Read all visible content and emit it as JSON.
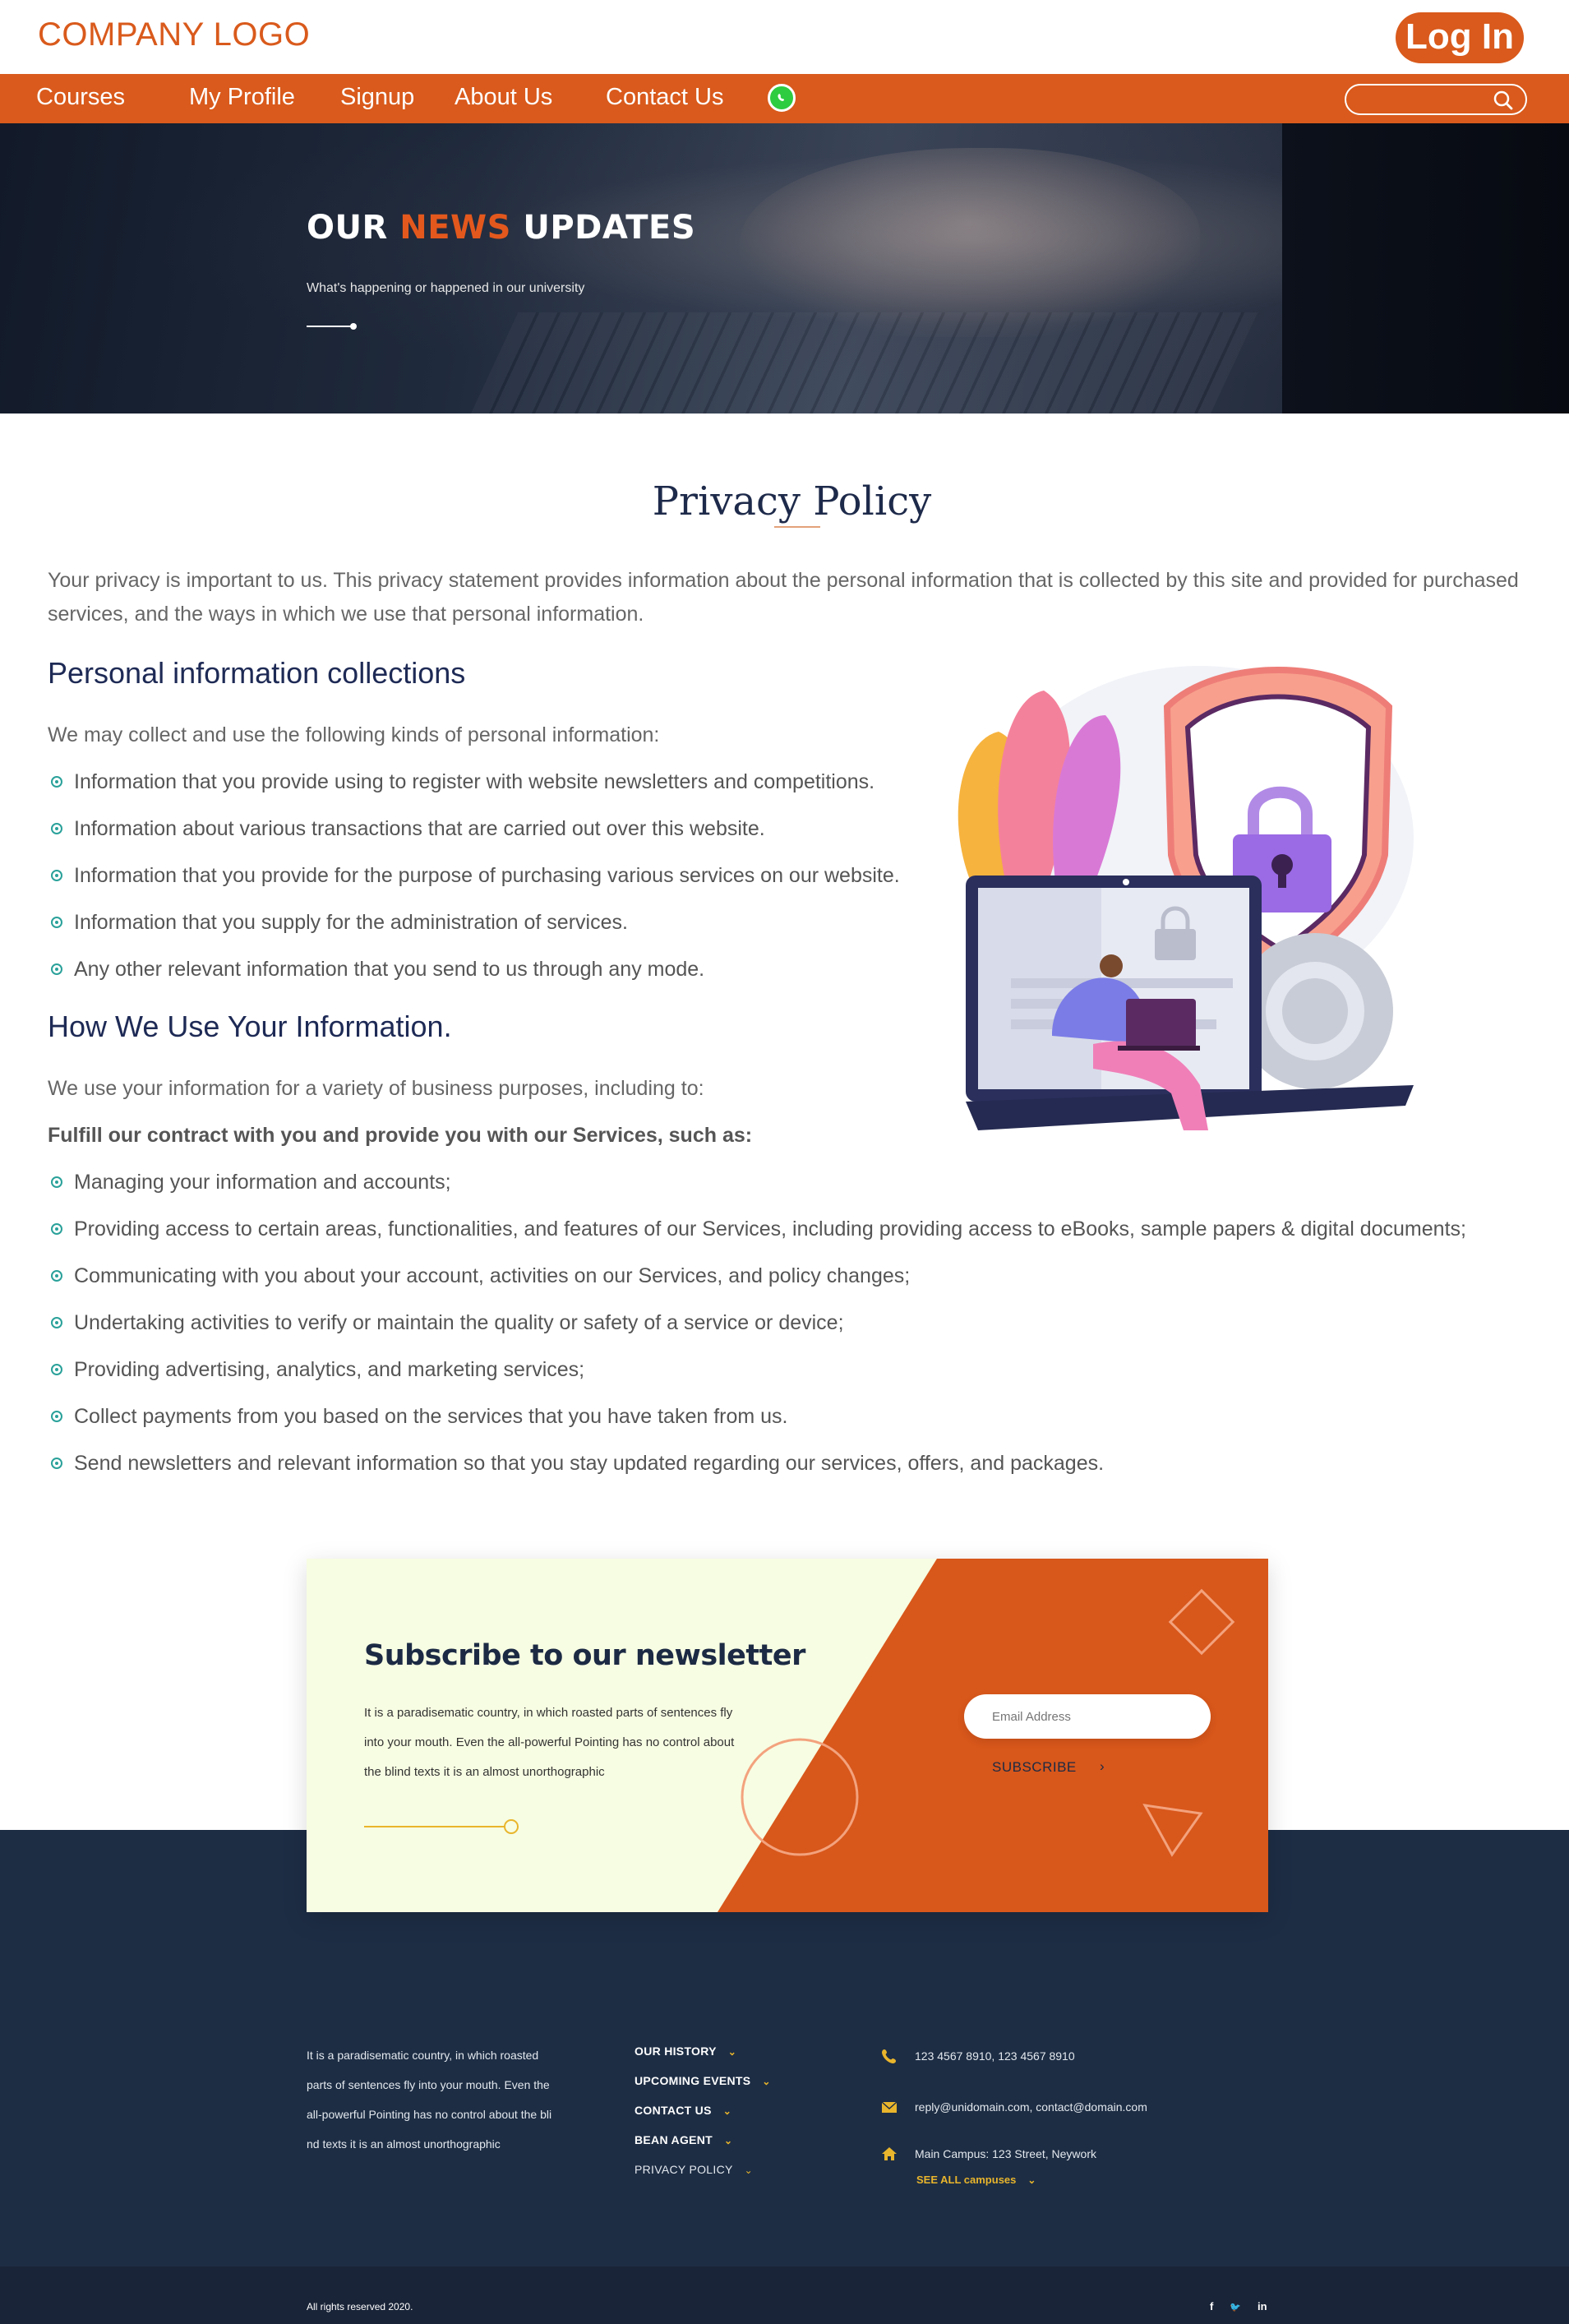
{
  "header": {
    "logo": "COMPANY LOGO",
    "login_label": "Log In"
  },
  "nav": {
    "items": [
      {
        "label": "Courses"
      },
      {
        "label": "My Profile"
      },
      {
        "label": "Signup"
      },
      {
        "label": "About Us"
      },
      {
        "label": "Contact Us"
      }
    ],
    "whatsapp_icon": "whatsapp-icon",
    "search_placeholder": ""
  },
  "hero": {
    "title_part1": "OUR ",
    "title_accent": "NEWS",
    "title_part2": " UPDATES",
    "subtitle": "What's happening or happened in our university"
  },
  "content": {
    "title": "Privacy Policy",
    "intro": "Your privacy is important to us. This privacy statement provides information about the personal information that is collected by this site and provided for purchased services, and the ways in which we use that personal information.",
    "section1": {
      "heading": "Personal information collections",
      "lead": "We may collect and use the following kinds of personal information:",
      "items": [
        "Information that you provide using to register with website newsletters and competitions.",
        "Information about various transactions that are carried out over this website.",
        "Information that you provide for the purpose of purchasing various services on our website.",
        "Information that you supply for the administration of services.",
        "Any other relevant information that you send to us through any mode."
      ]
    },
    "section2": {
      "heading": "How We Use Your Information.",
      "lead": "We use your information for a variety of business purposes, including to:",
      "sublead": "Fulfill our contract with you and provide you with our Services, such as:",
      "items": [
        "Managing your information and accounts;",
        "Providing access to certain areas, functionalities, and features of our Services, including providing access to eBooks, sample papers & digital documents;",
        "Communicating with you about your account, activities on our Services, and policy changes;",
        "Undertaking activities to verify or maintain the quality or safety of a service or device;",
        "Providing advertising, analytics, and marketing services;",
        "Collect payments from you based on the services that you have taken from us.",
        "Send newsletters and relevant information so that you stay updated regarding our services, offers, and packages."
      ]
    }
  },
  "newsletter": {
    "title": "Subscribe to our newsletter",
    "text": "It is a paradisematic country, in which roasted parts of sentences fly into your mouth. Even the all-powerful Pointing has no control about the blind texts it is an almost unorthographic",
    "email_placeholder": "Email Address",
    "subscribe_label": "SUBSCRIBE",
    "subscribe_arrow": "›"
  },
  "footer": {
    "about": "It is a paradisematic country, in which roasted parts of sentences fly into your mouth. Even the all-powerful Pointing has no control about the bli nd texts it is an almost unorthographic",
    "links": [
      {
        "label": "OUR HISTORY"
      },
      {
        "label": "UPCOMING EVENTS"
      },
      {
        "label": "CONTACT US"
      },
      {
        "label": "BEAN AGENT"
      },
      {
        "label": "PRIVACY POLICY"
      }
    ],
    "phone": "123 4567 8910, 123 4567 8910",
    "email": "reply@unidomain.com, contact@domain.com",
    "address": "Main Campus: 123 Street, Neywork",
    "see_all": "SEE ALL campuses",
    "copyright": "All rights reserved 2020.",
    "social": [
      {
        "label": "f",
        "icon": "facebook-icon"
      },
      {
        "label": "🐦",
        "icon": "twitter-icon"
      },
      {
        "label": "in",
        "icon": "linkedin-icon"
      }
    ]
  },
  "colors": {
    "brand_orange": "#d95a1c",
    "footer_navy": "#1d2d44",
    "accent_yellow": "#e9b52c",
    "bullet_teal": "#2aa19a"
  }
}
